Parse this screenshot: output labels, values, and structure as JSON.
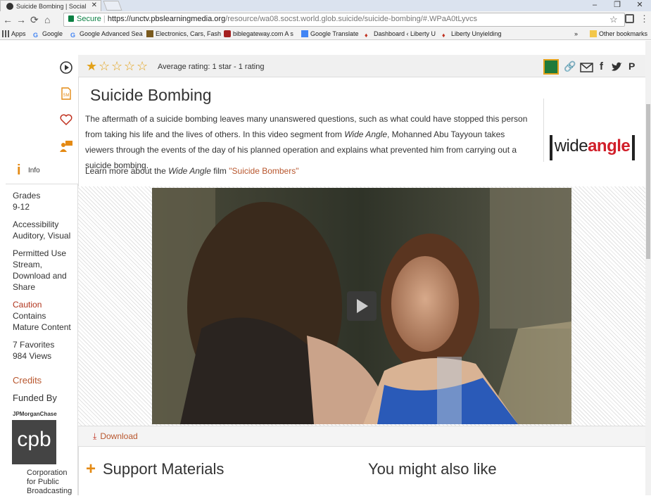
{
  "browser": {
    "tab_title": "Suicide Bombing | Social",
    "tab_close": "✕",
    "secure_label": "Secure",
    "url_domain": "https://unctv.pbslearningmedia.org",
    "url_path": "/resource/wa08.socst.world.glob.suicide/suicide-bombing/#.WPaA0tLyvcs",
    "bookmarks": [
      "Apps",
      "Google",
      "Google Advanced Sea",
      "Electronics, Cars, Fash",
      "biblegateway.com A s",
      "Google Translate",
      "Dashboard ‹ Liberty U",
      "Liberty Unyielding"
    ],
    "bookmarks_overflow": "»",
    "other_bookmarks": "Other bookmarks"
  },
  "sidebar": {
    "info_label": "Info",
    "grades_label": "Grades",
    "grades_value": "9-12",
    "accessibility_label": "Accessibility",
    "accessibility_value": "Auditory, Visual",
    "permitted_label": "Permitted Use",
    "permitted_value_1": "Stream,",
    "permitted_value_2": "Download and",
    "permitted_value_3": "Share",
    "caution_label": "Caution",
    "caution_value_1": "Contains",
    "caution_value_2": "Mature Content",
    "favorites": "7 Favorites",
    "views": "984 Views",
    "credits_label": "Credits",
    "funded_label": "Funded By",
    "funder_1": "JPMorganChase",
    "cpb_logo_text": "cpb",
    "funder_2_line1": "Corporation",
    "funder_2_line2": "for Public",
    "funder_2_line3": "Broadcasting"
  },
  "rating": {
    "stars_filled": 1,
    "stars_total": 5,
    "average_text": "Average rating: 1 star - 1 rating"
  },
  "resource": {
    "title": "Suicide Bombing",
    "desc_1": "The aftermath of a suicide bombing leaves many unanswered questions, such as what could have stopped this person from taking his life and the lives of others.  In this video segment from ",
    "desc_em": "Wide Angle",
    "desc_2": ", Mohanned Abu Tayyoun takes viewers through the events of the day of his planned operation and explains what prevented him from carrying out a suicide bombing.",
    "learn_1": "Learn more about the ",
    "learn_em": "Wide Angle",
    "learn_2": " film ",
    "learn_link": "\"Suicide Bombers\"",
    "logo_text_a": "wide",
    "logo_text_b": "angle",
    "download_label": "Download"
  },
  "sections": {
    "support": "Support Materials",
    "also_like": "You might also like"
  },
  "colors": {
    "accent": "#b8562d",
    "star": "#e3a21a",
    "logo_red": "#d11f2a"
  }
}
